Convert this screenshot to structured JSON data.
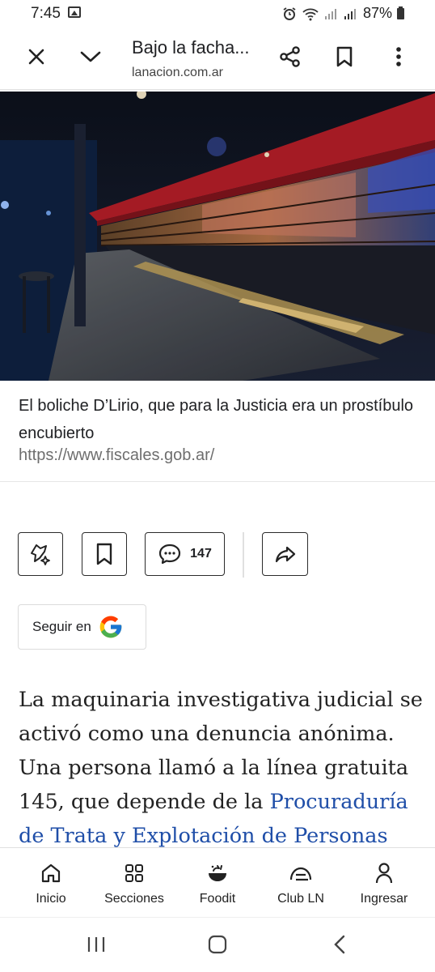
{
  "status": {
    "time": "7:45",
    "battery": "87%"
  },
  "toolbar": {
    "title": "Bajo la facha...",
    "url": "lanacion.com.ar"
  },
  "article": {
    "caption": "El boliche D’Lirio, que para la Justicia era un prostíbulo encubierto",
    "credit": "https://www.fiscales.gob.ar/",
    "comments_count": "147",
    "follow_label": "Seguir en",
    "body_text": "La maquinaria investigativa judicial se activó como una denuncia anónima. Una persona llamó a la línea gratuita 145, que depende de la ",
    "body_link": "Procuraduría de Trata y Explotación de Personas"
  },
  "bottom_nav": {
    "items": [
      {
        "label": "Inicio",
        "icon": "home-icon"
      },
      {
        "label": "Secciones",
        "icon": "grid-icon"
      },
      {
        "label": "Foodit",
        "icon": "food-bowl-icon"
      },
      {
        "label": "Club LN",
        "icon": "club-card-icon"
      },
      {
        "label": "Ingresar",
        "icon": "person-icon"
      }
    ]
  },
  "colors": {
    "link": "#1f4ea8",
    "text": "#202124",
    "muted": "#6e6e6e"
  }
}
